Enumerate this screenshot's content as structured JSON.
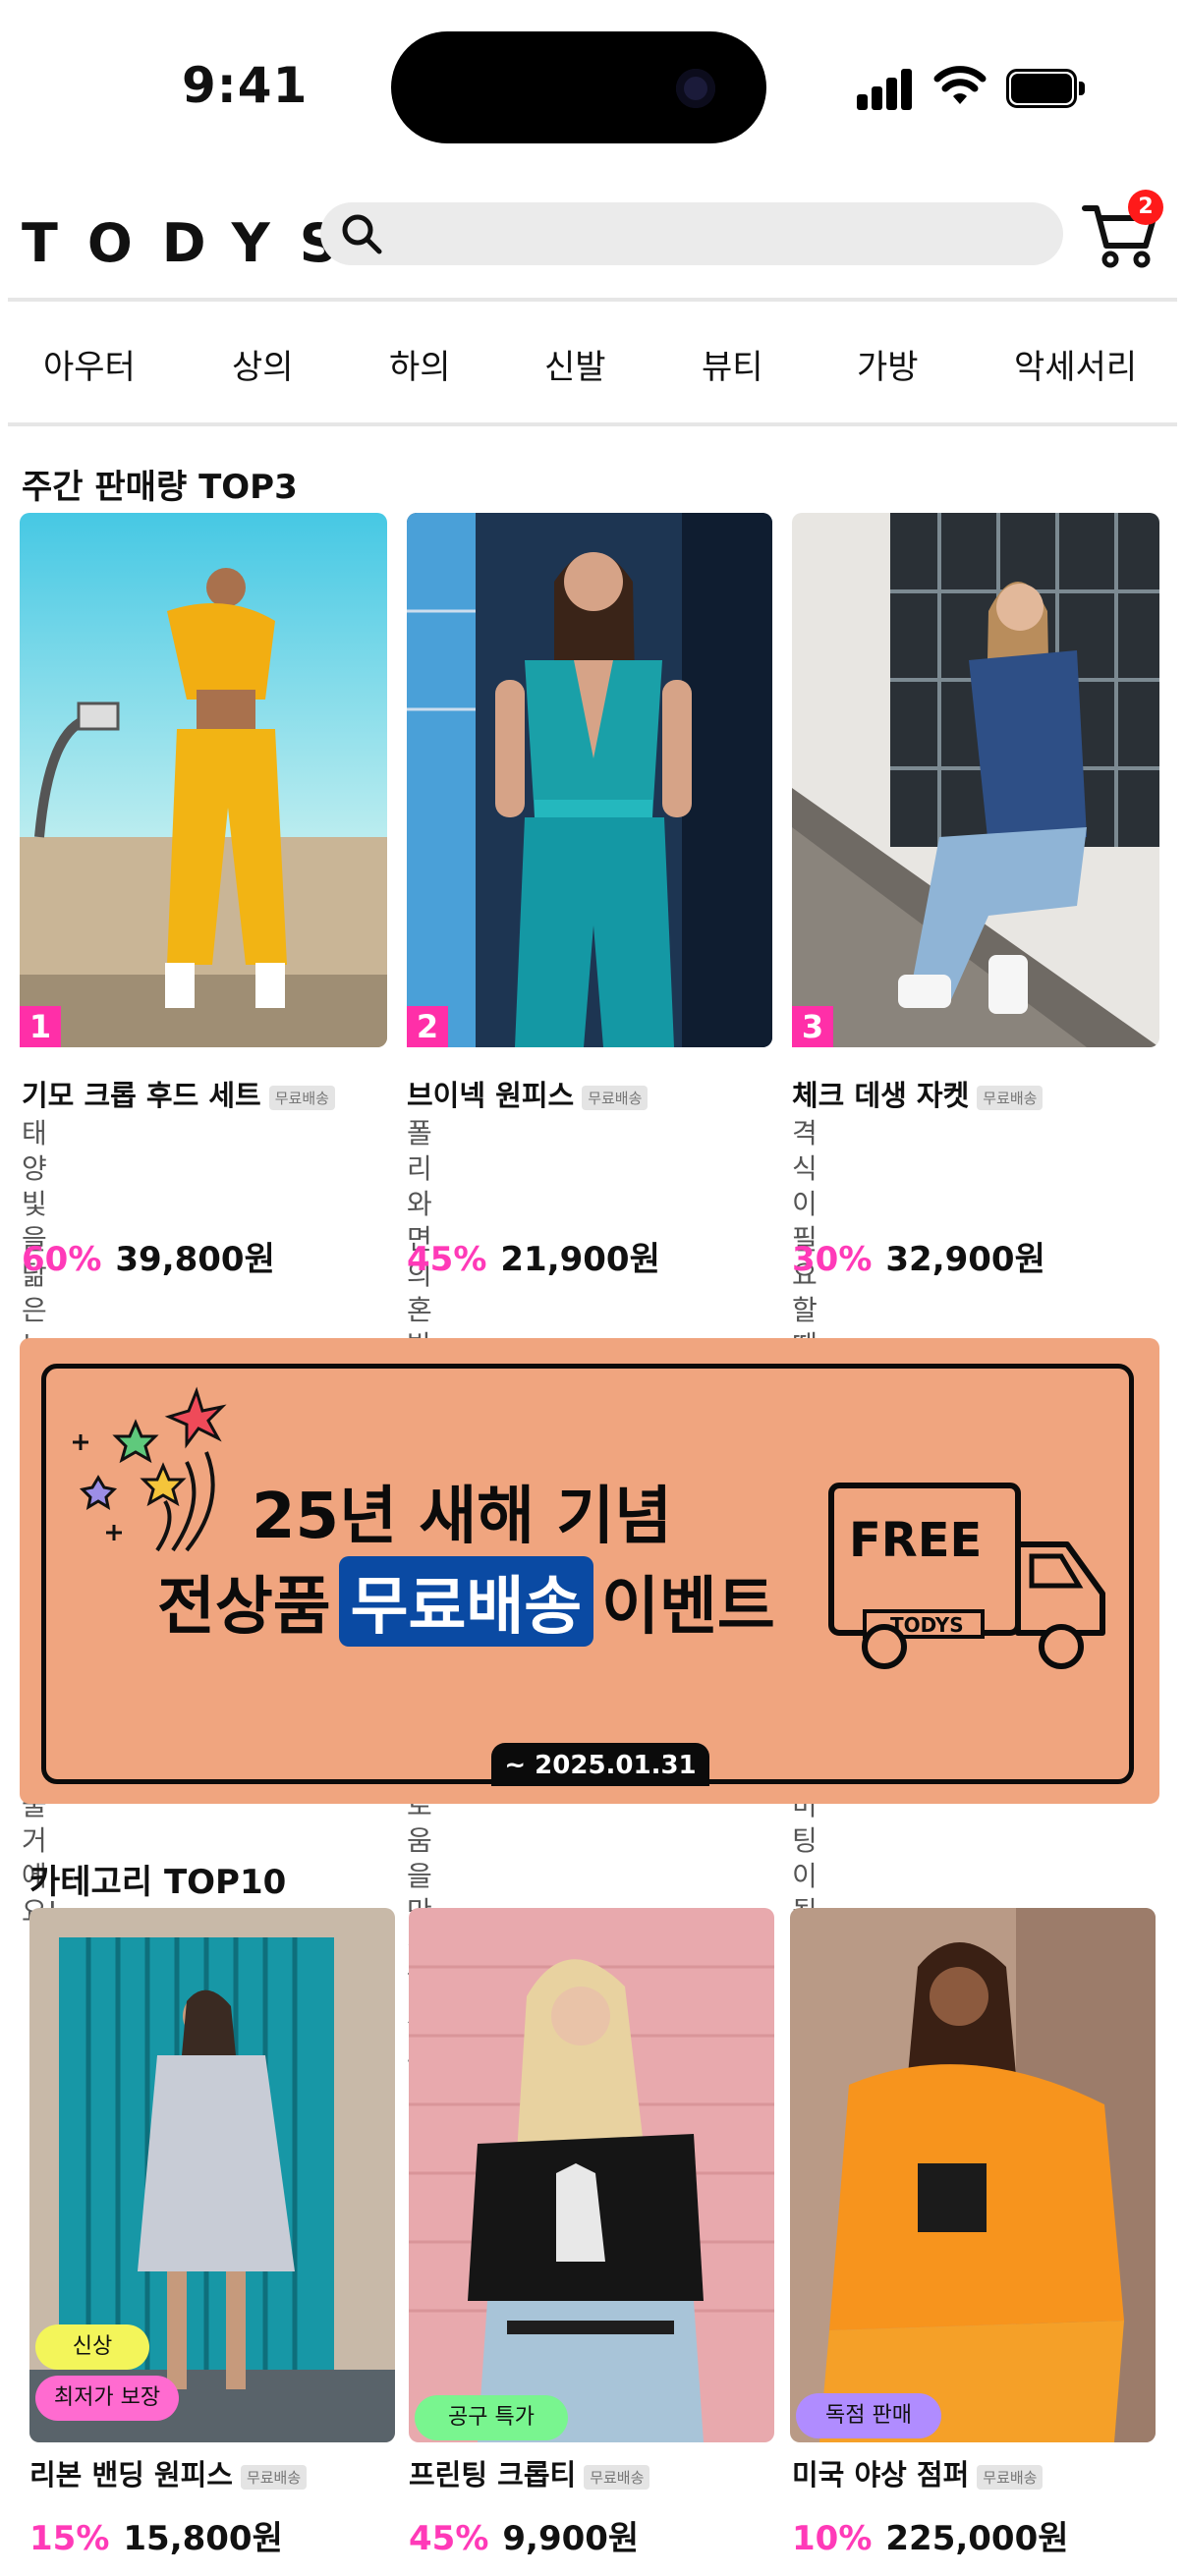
{
  "status_bar": {
    "time": "9:41"
  },
  "header": {
    "logo": "TODYS",
    "search_placeholder": "",
    "cart_count": "2"
  },
  "nav": {
    "items": [
      "아우터",
      "상의",
      "하의",
      "신발",
      "뷰티",
      "가방",
      "악세서리"
    ]
  },
  "weekly_top": {
    "title": "주간 판매량 TOP3",
    "products": [
      {
        "rank": "1",
        "name": "기모 크롭 후드 세트",
        "shipping": "무료배송",
        "desc": "태양빛을 닮은 노란색이\n어딜가든 주목받게\n해줄거에요!",
        "discount": "60%",
        "price": "39,800원"
      },
      {
        "rank": "2",
        "name": "브이넥 원피스",
        "shipping": "무료배송",
        "desc": "폴리와 면의 혼방소재로\n특별한 날 최고의\n자유로움을 만끽하세요!",
        "discount": "45%",
        "price": "21,900원"
      },
      {
        "rank": "3",
        "name": "체크 데생 자켓",
        "shipping": "무료배송",
        "desc": "격식이 필요할때도\n꾸민듯 안 꾸민듯 성공적인\n미팅이 될거에요!",
        "discount": "30%",
        "price": "32,900원"
      }
    ]
  },
  "banner": {
    "line1": "25년 새해 기념",
    "line2_before": "전상품",
    "line2_highlight": "무료배송",
    "line2_after": "이벤트",
    "truck_text": "FREE",
    "truck_brand": "TODYS",
    "date": "~ 2025.01.31"
  },
  "category_top": {
    "title": "카테고리 TOP10",
    "products": [
      {
        "name": "리본 밴딩 원피스",
        "shipping": "무료배송",
        "discount": "15%",
        "price": "15,800원",
        "tags": [
          "신상",
          "최저가 보장"
        ]
      },
      {
        "name": "프린팅 크롭티",
        "shipping": "무료배송",
        "discount": "45%",
        "price": "9,900원",
        "tags": [
          "공구 특가"
        ]
      },
      {
        "name": "미국 야상 점퍼",
        "shipping": "무료배송",
        "discount": "10%",
        "price": "225,000원",
        "tags": [
          "독점 판매"
        ]
      }
    ]
  },
  "colors": {
    "accent_pink": "#ff3ab8",
    "banner_bg": "#f0a57f",
    "banner_highlight": "#0a4aa3",
    "tag_yellow": "#f3f55a",
    "tag_pink": "#ff6bd0",
    "tag_green": "#79f58f",
    "tag_purple": "#b08cff"
  }
}
